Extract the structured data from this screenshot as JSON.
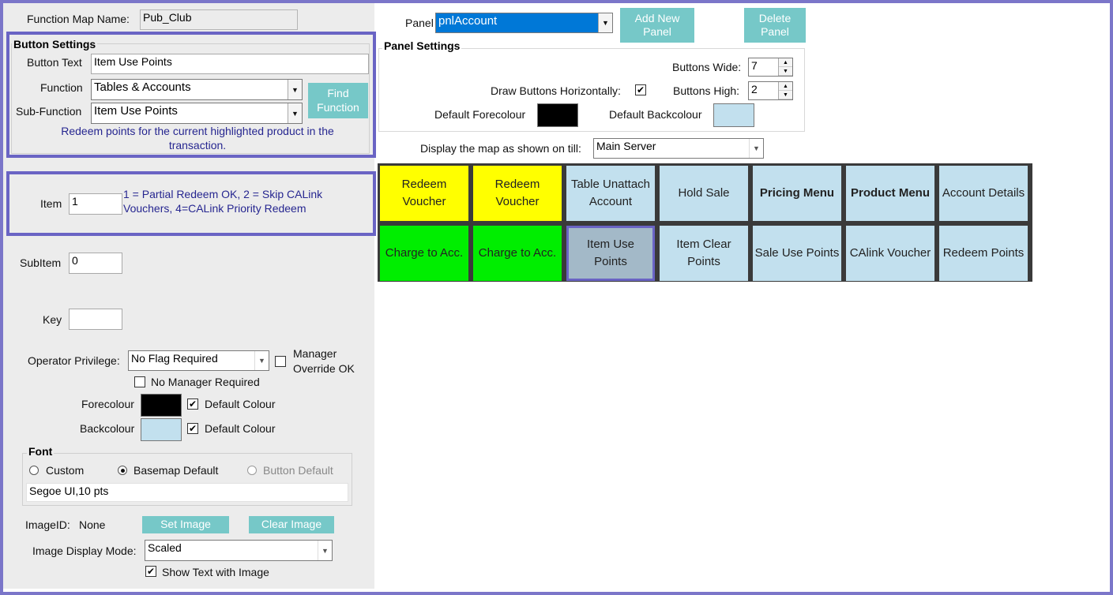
{
  "left": {
    "map_name_label": "Function Map Name:",
    "map_name_value": "Pub_Club",
    "button_settings": {
      "title": "Button Settings",
      "button_text_label": "Button Text",
      "button_text_value": "Item Use Points",
      "function_label": "Function",
      "function_value": "Tables & Accounts",
      "subfunction_label": "Sub-Function",
      "subfunction_value": "Item Use Points",
      "find_function_label": "Find Function",
      "description": "Redeem points for the current highlighted product in the transaction."
    },
    "item": {
      "label": "Item",
      "value": "1",
      "hint": "1 = Partial Redeem OK, 2 = Skip CALink Vouchers, 4=CALink Priority Redeem"
    },
    "subitem": {
      "label": "SubItem",
      "value": "0"
    },
    "key": {
      "label": "Key",
      "value": ""
    },
    "privilege": {
      "label": "Operator Privilege:",
      "value": "No Flag Required",
      "manager_override_label": "Manager Override OK",
      "manager_override_checked": false,
      "no_manager_label": "No Manager Required",
      "no_manager_checked": false
    },
    "colours": {
      "fore_label": "Forecolour",
      "fore_color": "#000000",
      "fore_default_label": "Default Colour",
      "fore_default_checked": true,
      "back_label": "Backcolour",
      "back_color": "#c2e0ee",
      "back_default_label": "Default Colour",
      "back_default_checked": true
    },
    "font": {
      "title": "Font",
      "custom_label": "Custom",
      "basemap_label": "Basemap Default",
      "button_default_label": "Button Default",
      "selected": "basemap",
      "value": "Segoe UI,10 pts"
    },
    "image": {
      "id_label": "ImageID:",
      "id_value": "None",
      "set_label": "Set Image",
      "clear_label": "Clear Image",
      "mode_label": "Image Display Mode:",
      "mode_value": "Scaled",
      "show_text_label": "Show Text with Image",
      "show_text_checked": true
    }
  },
  "panel": {
    "label": "Panel",
    "value": "pnlAccount",
    "add_label": "Add New Panel",
    "delete_label": "Delete Panel",
    "settings_title": "Panel Settings",
    "buttons_wide_label": "Buttons Wide:",
    "buttons_wide_value": "7",
    "buttons_high_label": "Buttons High:",
    "buttons_high_value": "2",
    "draw_horiz_label": "Draw Buttons Horizontally:",
    "draw_horiz_checked": true,
    "default_fore_label": "Default Forecolour",
    "default_fore_color": "#000000",
    "default_back_label": "Default Backcolour",
    "default_back_color": "#c2e0ee",
    "display_label": "Display the map as shown on till:",
    "display_value": "Main Server"
  },
  "tiles": [
    {
      "label": "Redeem Voucher",
      "color": "yellow",
      "bold": false
    },
    {
      "label": "Redeem Voucher",
      "color": "yellow",
      "bold": false
    },
    {
      "label": "Table Unattach Account",
      "color": "blue",
      "bold": false
    },
    {
      "label": "Hold Sale",
      "color": "blue",
      "bold": false
    },
    {
      "label": "Pricing Menu",
      "color": "blue",
      "bold": true
    },
    {
      "label": "Product Menu",
      "color": "blue",
      "bold": true
    },
    {
      "label": "Account Details",
      "color": "blue",
      "bold": false
    },
    {
      "label": "Charge to Acc.",
      "color": "green",
      "bold": false
    },
    {
      "label": "Charge to Acc.",
      "color": "green",
      "bold": false
    },
    {
      "label": "Item Use Points",
      "color": "blue",
      "bold": false,
      "selected": true
    },
    {
      "label": "Item Clear Points",
      "color": "blue",
      "bold": false
    },
    {
      "label": "Sale Use Points",
      "color": "blue",
      "bold": false
    },
    {
      "label": "CAlink Voucher",
      "color": "blue",
      "bold": false
    },
    {
      "label": "Redeem Points",
      "color": "blue",
      "bold": false
    }
  ],
  "icons": {
    "dropdown": "chevron-down-icon",
    "spin_up": "spin-up-icon",
    "spin_down": "spin-down-icon",
    "check": "checkmark-icon"
  }
}
